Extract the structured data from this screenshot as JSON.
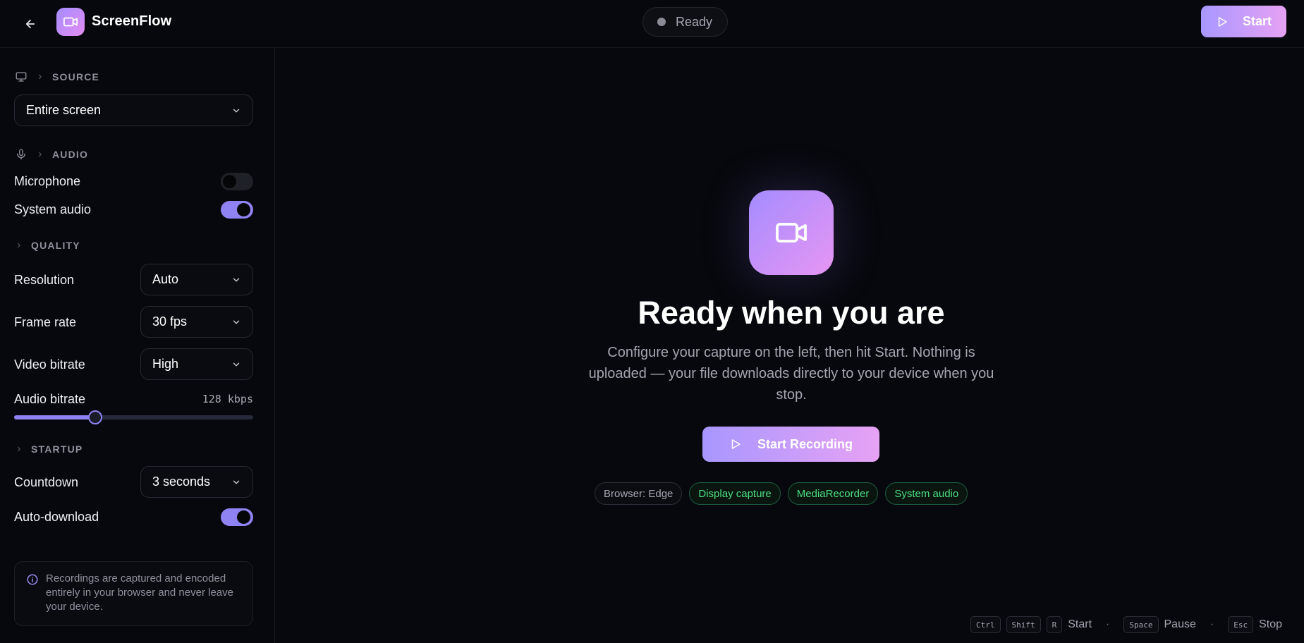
{
  "header": {
    "app_title": "ScreenFlow",
    "status": "Ready",
    "start_label": "Start",
    "icons": [
      "arrow-left-icon",
      "video-camera-icon",
      "play-icon"
    ]
  },
  "sidebar": {
    "source": {
      "heading": "SOURCE",
      "value": "Entire screen"
    },
    "audio": {
      "heading": "AUDIO",
      "microphone_label": "Microphone",
      "microphone_on": false,
      "system_audio_label": "System audio",
      "system_audio_on": true
    },
    "quality": {
      "heading": "QUALITY",
      "resolution_label": "Resolution",
      "resolution_value": "Auto",
      "frame_rate_label": "Frame rate",
      "frame_rate_value": "30 fps",
      "video_bitrate_label": "Video bitrate",
      "video_bitrate_value": "High",
      "audio_bitrate_label": "Audio bitrate",
      "audio_bitrate_value": "128 kbps",
      "audio_bitrate_level": 0.34
    },
    "startup": {
      "heading": "STARTUP",
      "countdown_label": "Countdown",
      "countdown_value": "3 seconds",
      "auto_download_label": "Auto-download",
      "auto_download_on": true
    },
    "info": "Recordings are captured and encoded entirely in your browser and never leave your device."
  },
  "main": {
    "title": "Ready when you are",
    "description": "Configure your capture on the left, then hit Start. Nothing is uploaded — your file downloads directly to your device when you stop.",
    "start_recording_label": "Start Recording",
    "chips": [
      {
        "label": "Browser: Edge",
        "status": "neutral"
      },
      {
        "label": "Display capture",
        "status": "supported"
      },
      {
        "label": "MediaRecorder",
        "status": "supported"
      },
      {
        "label": "System audio",
        "status": "supported"
      }
    ]
  },
  "shortcuts": {
    "ctrl": "Ctrl",
    "shift": "Shift",
    "r": "R",
    "start": "Start",
    "space": "Space",
    "pause": "Pause",
    "esc": "Esc",
    "stop": "Stop",
    "dot": "·"
  },
  "colors": {
    "accent": "#8f83f3",
    "gradient_start": "#a897ff",
    "gradient_end": "#e7a2f4",
    "supported_green": "#4ade80",
    "background": "#07080d"
  }
}
